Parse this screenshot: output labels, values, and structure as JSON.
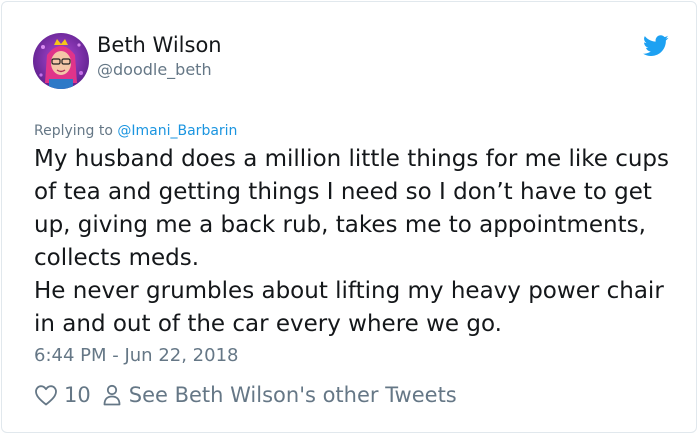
{
  "tweet": {
    "author_name": "Beth Wilson",
    "author_handle": "@doodle_beth",
    "replying_prefix": "Replying to ",
    "replying_to": "@Imani_Barbarin",
    "text": "My husband does a million little things for me like cups of tea and getting things I need so I don’t have to get up, giving me a back rub, takes me to appointments, collects meds.\nHe never grumbles about lifting my heavy power chair in and out of the car every where we go.",
    "timestamp": "6:44 PM - Jun 22, 2018",
    "like_count": "10",
    "other_tweets_label": "See Beth Wilson's other Tweets"
  },
  "icons": {
    "brand": "twitter-bird-icon",
    "like": "heart-icon",
    "profile": "person-icon"
  },
  "colors": {
    "brand_blue": "#1da1f2",
    "secondary_text": "#657786",
    "link_blue": "#1b95e0",
    "primary_text": "#14171a"
  }
}
